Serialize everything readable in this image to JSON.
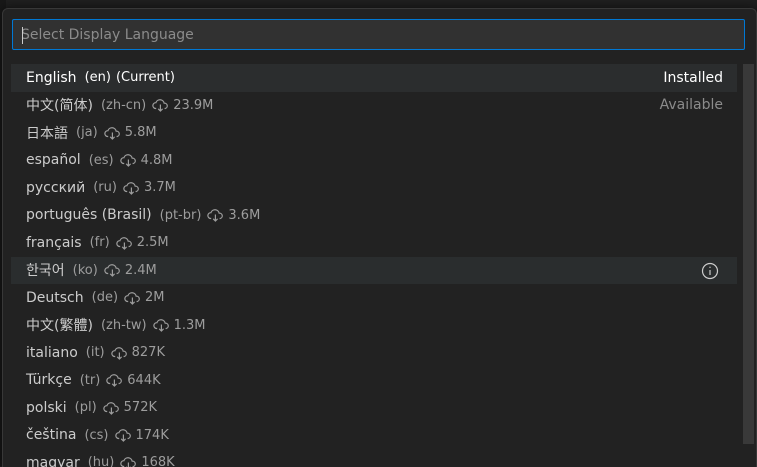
{
  "input": {
    "placeholder": "Select Display Language",
    "value": ""
  },
  "languages": [
    {
      "name": "English",
      "code": "(en)",
      "suffix": "(Current)",
      "size": "",
      "status": "Installed"
    },
    {
      "name": "中文(简体)",
      "code": "(zh-cn)",
      "suffix": "",
      "size": "23.9M",
      "status": "Available"
    },
    {
      "name": "日本語",
      "code": "(ja)",
      "suffix": "",
      "size": "5.8M",
      "status": ""
    },
    {
      "name": "español",
      "code": "(es)",
      "suffix": "",
      "size": "4.8M",
      "status": ""
    },
    {
      "name": "русский",
      "code": "(ru)",
      "suffix": "",
      "size": "3.7M",
      "status": ""
    },
    {
      "name": "português (Brasil)",
      "code": "(pt-br)",
      "suffix": "",
      "size": "3.6M",
      "status": ""
    },
    {
      "name": "français",
      "code": "(fr)",
      "suffix": "",
      "size": "2.5M",
      "status": ""
    },
    {
      "name": "한국어",
      "code": "(ko)",
      "suffix": "",
      "size": "2.4M",
      "status": ""
    },
    {
      "name": "Deutsch",
      "code": "(de)",
      "suffix": "",
      "size": "2M",
      "status": ""
    },
    {
      "name": "中文(繁體)",
      "code": "(zh-tw)",
      "suffix": "",
      "size": "1.3M",
      "status": ""
    },
    {
      "name": "italiano",
      "code": "(it)",
      "suffix": "",
      "size": "827K",
      "status": ""
    },
    {
      "name": "Türkçe",
      "code": "(tr)",
      "suffix": "",
      "size": "644K",
      "status": ""
    },
    {
      "name": "polski",
      "code": "(pl)",
      "suffix": "",
      "size": "572K",
      "status": ""
    },
    {
      "name": "čeština",
      "code": "(cs)",
      "suffix": "",
      "size": "174K",
      "status": ""
    },
    {
      "name": "magyar",
      "code": "(hu)",
      "suffix": "",
      "size": "168K",
      "status": ""
    }
  ],
  "icons": {
    "download": "cloud-download-icon",
    "info": "info-icon"
  },
  "colors": {
    "focus_border": "#0078d4",
    "background": "#222222",
    "active_row": "#2b2d2e"
  }
}
